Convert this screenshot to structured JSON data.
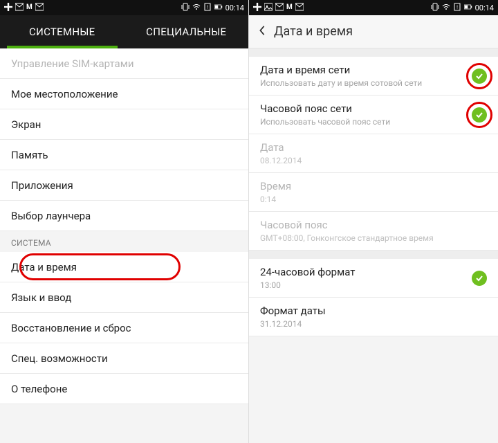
{
  "status": {
    "time": "00:14"
  },
  "left": {
    "tabs": [
      {
        "label": "СИСТЕМНЫЕ",
        "active": true
      },
      {
        "label": "СПЕЦИАЛЬНЫЕ",
        "active": false
      }
    ],
    "group1": [
      {
        "label": "Управление SIM-картами",
        "disabled": true
      },
      {
        "label": "Мое местоположение"
      },
      {
        "label": "Экран"
      },
      {
        "label": "Память"
      },
      {
        "label": "Приложения"
      },
      {
        "label": "Выбор лаунчера"
      }
    ],
    "sectionLabel": "СИСТЕМА",
    "group2": [
      {
        "label": "Дата и время",
        "highlight": true
      },
      {
        "label": "Язык и ввод"
      },
      {
        "label": "Восстановление и сброс"
      },
      {
        "label": "Спец. возможности"
      },
      {
        "label": "О телефоне"
      }
    ]
  },
  "right": {
    "title": "Дата и время",
    "rows": [
      {
        "label": "Дата и время сети",
        "sub": "Использовать дату и время сотовой сети",
        "checked": true,
        "hlCircle": true
      },
      {
        "label": "Часовой пояс сети",
        "sub": "Использовать часовой пояс сети",
        "checked": true,
        "hlCircle": true
      },
      {
        "label": "Дата",
        "sub": "08.12.2014",
        "disabled": true
      },
      {
        "label": "Время",
        "sub": "0:14",
        "disabled": true
      },
      {
        "label": "Часовой пояс",
        "sub": "GMT+08:00, Гонконгское стандартное время",
        "disabled": true
      },
      {
        "label": "24-часовой формат",
        "sub": "13:00",
        "checked": true
      },
      {
        "label": "Формат даты",
        "sub": "31.12.2014"
      }
    ]
  },
  "icons": {
    "plus": "plus-icon",
    "envelope": "envelope-icon",
    "mlabel": "M",
    "picture": "picture-icon",
    "vibrate": "vibrate-icon",
    "wifi": "wifi-icon",
    "card": "card-icon",
    "battery": "battery-icon"
  },
  "colors": {
    "accent": "#6fbf1f",
    "highlight": "#e00000",
    "tabUnderline": "#4caf0f"
  }
}
